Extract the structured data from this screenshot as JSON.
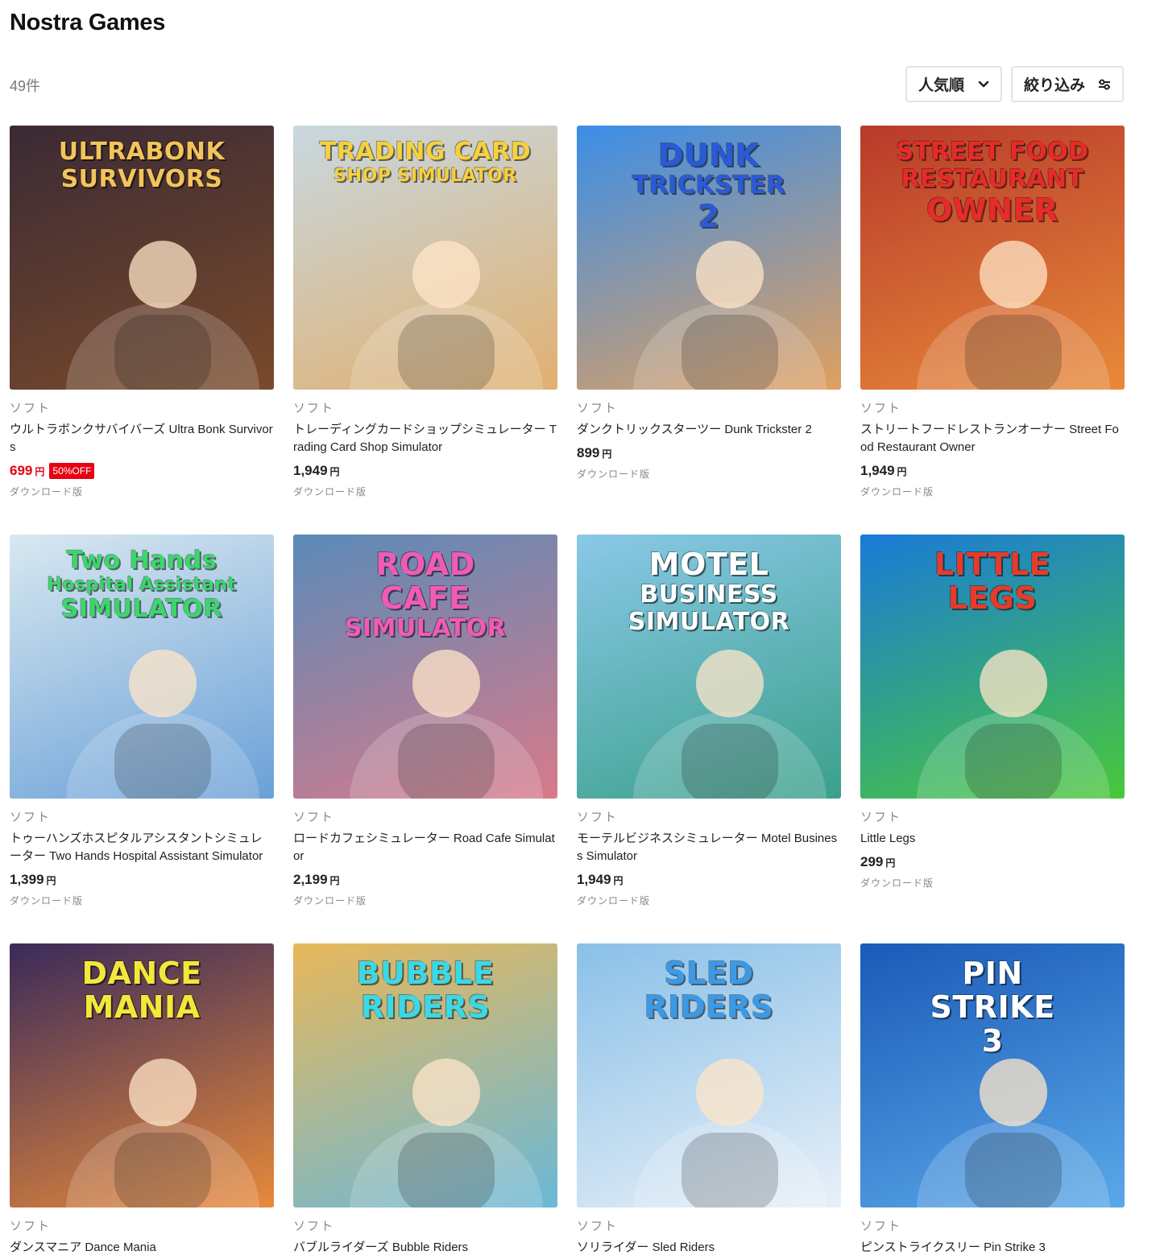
{
  "page": {
    "title": "Nostra Games",
    "count": "49件"
  },
  "toolbar": {
    "sort_label": "人気順",
    "filter_label": "絞り込み"
  },
  "products": [
    {
      "thumb_text": [
        "ULTRABONK",
        "SURVIVORS"
      ],
      "thumb_colors": [
        "#3a2a35",
        "#7a4a2a"
      ],
      "text_color": "#f2c45a",
      "category": "ソフト",
      "name": "ウルトラボンクサバイバーズ Ultra Bonk Survivors",
      "price": "699",
      "currency": "円",
      "discount": "50%OFF",
      "sale": true,
      "format": "ダウンロード版"
    },
    {
      "thumb_text": [
        "TRADING CARD",
        "SHOP SIMULATOR"
      ],
      "thumb_colors": [
        "#c8d8e0",
        "#e0b070"
      ],
      "text_color": "#f7d13a",
      "category": "ソフト",
      "name": "トレーディングカードショップシミュレーター Trading Card Shop Simulator",
      "price": "1,949",
      "currency": "円",
      "discount": "",
      "sale": false,
      "format": "ダウンロード版"
    },
    {
      "thumb_text": [
        "DUNK",
        "TRICKSTER",
        "2"
      ],
      "thumb_colors": [
        "#3a8ee8",
        "#e0a060"
      ],
      "text_color": "#2a5ad8",
      "category": "ソフト",
      "name": "ダンクトリックスターツー Dunk Trickster 2",
      "price": "899",
      "currency": "円",
      "discount": "",
      "sale": false,
      "format": "ダウンロード版"
    },
    {
      "thumb_text": [
        "STREET FOOD",
        "RESTAURANT",
        "OWNER"
      ],
      "thumb_colors": [
        "#b83a2a",
        "#e88a3a"
      ],
      "text_color": "#e82a2a",
      "category": "ソフト",
      "name": "ストリートフードレストランオーナー Street Food Restaurant Owner",
      "price": "1,949",
      "currency": "円",
      "discount": "",
      "sale": false,
      "format": "ダウンロード版"
    },
    {
      "thumb_text": [
        "Two Hands",
        "Hospital Assistant",
        "SIMULATOR"
      ],
      "thumb_colors": [
        "#d8e8f0",
        "#6aa0d8"
      ],
      "text_color": "#3ad86a",
      "category": "ソフト",
      "name": "トゥーハンズホスピタルアシスタントシミュレーター Two Hands Hospital Assistant Simulator",
      "price": "1,399",
      "currency": "円",
      "discount": "",
      "sale": false,
      "format": "ダウンロード版"
    },
    {
      "thumb_text": [
        "ROAD",
        "CAFE",
        "SIMULATOR"
      ],
      "thumb_colors": [
        "#5a8ab8",
        "#d87a8a"
      ],
      "text_color": "#f25ab8",
      "category": "ソフト",
      "name": "ロードカフェシミュレーター Road Cafe Simulator",
      "price": "2,199",
      "currency": "円",
      "discount": "",
      "sale": false,
      "format": "ダウンロード版"
    },
    {
      "thumb_text": [
        "MOTEL",
        "BUSINESS",
        "SIMULATOR"
      ],
      "thumb_colors": [
        "#8ac8e8",
        "#3aa08a"
      ],
      "text_color": "#ffffff",
      "category": "ソフト",
      "name": "モーテルビジネスシミュレーター Motel Business Simulator",
      "price": "1,949",
      "currency": "円",
      "discount": "",
      "sale": false,
      "format": "ダウンロード版"
    },
    {
      "thumb_text": [
        "LITTLE",
        "LEGS"
      ],
      "thumb_colors": [
        "#1a7ad8",
        "#4ac83a"
      ],
      "text_color": "#e83a2a",
      "category": "ソフト",
      "name": "Little Legs",
      "price": "299",
      "currency": "円",
      "discount": "",
      "sale": false,
      "format": "ダウンロード版"
    },
    {
      "thumb_text": [
        "DANCE",
        "MANIA"
      ],
      "thumb_colors": [
        "#3a2a5a",
        "#e88a3a"
      ],
      "text_color": "#f2e83a",
      "category": "ソフト",
      "name": "ダンスマニア Dance Mania",
      "price": "",
      "currency": "",
      "discount": "",
      "sale": false,
      "format": ""
    },
    {
      "thumb_text": [
        "BUBBLE",
        "RIDERS"
      ],
      "thumb_colors": [
        "#e8b85a",
        "#6ab8d8"
      ],
      "text_color": "#3ad8e8",
      "category": "ソフト",
      "name": "バブルライダーズ Bubble Riders",
      "price": "",
      "currency": "",
      "discount": "",
      "sale": false,
      "format": ""
    },
    {
      "thumb_text": [
        "SLED",
        "RIDERS"
      ],
      "thumb_colors": [
        "#8ac0e8",
        "#e8f0f8"
      ],
      "text_color": "#3a9ae8",
      "category": "ソフト",
      "name": "ソリライダー Sled Riders",
      "price": "",
      "currency": "",
      "discount": "",
      "sale": false,
      "format": ""
    },
    {
      "thumb_text": [
        "PIN",
        "STRIKE",
        "3"
      ],
      "thumb_colors": [
        "#1a5ab8",
        "#5aa8e8"
      ],
      "text_color": "#ffffff",
      "category": "ソフト",
      "name": "ピンストライクスリー Pin Strike 3",
      "price": "",
      "currency": "",
      "discount": "",
      "sale": false,
      "format": ""
    }
  ]
}
